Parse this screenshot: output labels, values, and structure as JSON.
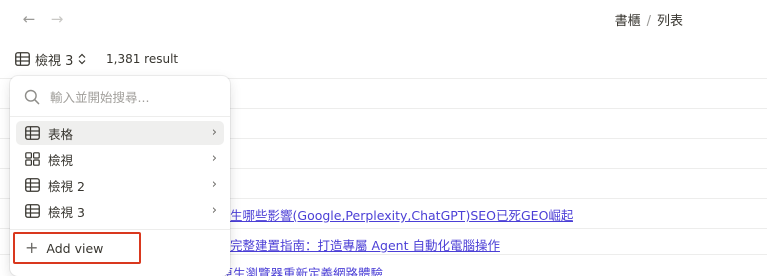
{
  "nav": {
    "back_glyph": "←",
    "forward_glyph": "→"
  },
  "breadcrumb": {
    "part1": "書櫃",
    "separator": "/",
    "part2": "列表"
  },
  "view_switcher": {
    "label": "檢視 3",
    "icon": "table-grid-icon",
    "arrows": "⌃⌄"
  },
  "result_count": "1,381 result",
  "table_rows": [
    "生哪些影響(Google,Perplexity,ChatGPT)SEO已死GEO崛起",
    "完整建置指南：打造專屬 Agent 自動化電腦操作",
    "【AI大神助】Perplexity Comet：AI原生瀏覽器重新定義網路體驗"
  ],
  "dropdown": {
    "search_placeholder": "輸入並開始搜尋...",
    "items": [
      {
        "label": "表格",
        "icon": "table-icon",
        "chevron": "›"
      },
      {
        "label": "檢視",
        "icon": "gallery-icon",
        "chevron": "›"
      },
      {
        "label": "檢視 2",
        "icon": "table-icon",
        "chevron": "›"
      },
      {
        "label": "檢視 3",
        "icon": "table-icon",
        "chevron": "›"
      }
    ],
    "add_view": {
      "plus": "+",
      "label": "Add view"
    }
  },
  "colors": {
    "link": "#4b3fd6",
    "highlight_border": "#d9381e",
    "active_item_bg": "#efefee"
  }
}
